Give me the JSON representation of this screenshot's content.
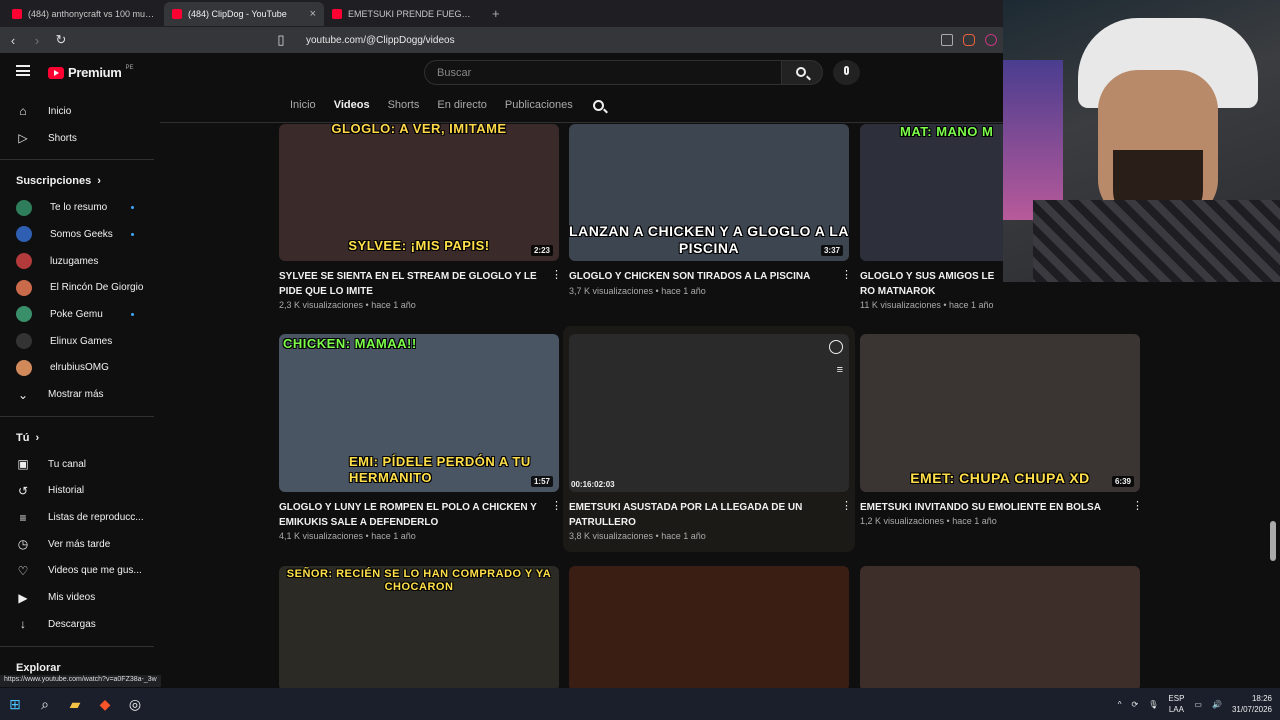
{
  "browser": {
    "tabs": [
      {
        "title": "(484) anthonycraft vs 100 mujeres - Y",
        "active": false
      },
      {
        "title": "(484) ClipDog - YouTube",
        "active": true
      },
      {
        "title": "EMETSUKI PRENDE FUEGOS ARTIFICI",
        "active": false
      }
    ],
    "new_tab": "+",
    "close_glyph": "×",
    "url": "youtube.com/@ClippDogg/videos",
    "status_url": "https://www.youtube.com/watch?v=a0FZ38a-_3w"
  },
  "youtube": {
    "logo_text": "Premium",
    "logo_region": "PE",
    "search_placeholder": "Buscar",
    "sidebar": {
      "main": [
        {
          "label": "Inicio",
          "icon": "home-icon"
        },
        {
          "label": "Shorts",
          "icon": "shorts-icon"
        }
      ],
      "subscriptions_header": "Suscripciones",
      "subscriptions": [
        {
          "label": "Te lo resumo",
          "color": "#2e7d5b",
          "new": true
        },
        {
          "label": "Somos Geeks",
          "color": "#2f5fb3",
          "new": true
        },
        {
          "label": "luzugames",
          "color": "#b33a3a",
          "new": false
        },
        {
          "label": "El Rincón De Giorgio",
          "color": "#c96a4a",
          "new": false
        },
        {
          "label": "Poke Gemu",
          "color": "#3a8f6b",
          "new": true
        },
        {
          "label": "Elinux Games",
          "color": "#333333",
          "new": false
        },
        {
          "label": "elrubiusOMG",
          "color": "#d08a5a",
          "new": false
        }
      ],
      "show_more": "Mostrar más",
      "you_header": "Tú",
      "you": [
        {
          "label": "Tu canal",
          "icon": "channel-icon"
        },
        {
          "label": "Historial",
          "icon": "history-icon"
        },
        {
          "label": "Listas de reproducc...",
          "icon": "playlist-icon"
        },
        {
          "label": "Ver más tarde",
          "icon": "watch-later-icon"
        },
        {
          "label": "Videos que me gus...",
          "icon": "like-icon"
        },
        {
          "label": "Mis videos",
          "icon": "my-videos-icon"
        },
        {
          "label": "Descargas",
          "icon": "download-icon"
        }
      ],
      "explore_header": "Explorar"
    },
    "channel_tabs": [
      {
        "label": "Inicio",
        "active": false
      },
      {
        "label": "Videos",
        "active": true
      },
      {
        "label": "Shorts",
        "active": false
      },
      {
        "label": "En directo",
        "active": false
      },
      {
        "label": "Publicaciones",
        "active": false
      }
    ],
    "videos": [
      {
        "caption_top": "GLOGLO: A VER, IMITAME",
        "caption": "SYLVEE: ¡MIS PAPIS!",
        "duration": "2:23",
        "title": "SYLVEE SE SIENTA EN EL STREAM DE GLOGLO  Y LE PIDE QUE LO IMITE",
        "meta": "2,3 K visualizaciones • hace 1 año",
        "bg": "#3a2a2a"
      },
      {
        "caption_top": "",
        "caption": "LANZAN A CHICKEN Y A GLOGLO A LA PISCINA",
        "duration": "3:37",
        "title": "GLOGLO Y CHICKEN SON TIRADOS A LA PISCINA",
        "meta": "3,7 K visualizaciones • hace 1 año",
        "bg": "#3d4550"
      },
      {
        "caption_top": "MAT: MANO M",
        "caption": "",
        "duration": "",
        "title": "GLOGLO Y SUS AMIGOS LE RO MATNAROK",
        "meta": "11 K visualizaciones • hace 1 año",
        "bg": "#2d2f3a"
      },
      {
        "caption_top": "CHICKEN: MAMAA!!",
        "caption": "EMI: PÍDELE PERDÓN A TU HERMANITO",
        "duration": "1:57",
        "title": "GLOGLO Y LUNY LE ROMPEN EL POLO A CHICKEN Y EMIKUKIS SALE A DEFENDERLO",
        "meta": "4,1 K visualizaciones • hace 1 año",
        "bg": "#4a5564"
      },
      {
        "caption_top": "",
        "caption": "",
        "duration": "00:16:02:03",
        "title": "EMETSUKI ASUSTADA POR LA LLEGADA DE UN PATRULLERO",
        "meta": "3,8 K visualizaciones • hace 1 año",
        "bg": "#2a2a2a"
      },
      {
        "caption_top": "",
        "caption": "EMET: CHUPA CHUPA XD",
        "duration": "6:39",
        "title": "EMETSUKI INVITANDO SU EMOLIENTE EN BOLSA",
        "meta": "1,2 K visualizaciones • hace 1 año",
        "bg": "#3a3432"
      },
      {
        "caption_top": "SEÑOR: RECIÉN SE LO HAN COMPRADO Y YA CHOCARON",
        "caption": "",
        "duration": "",
        "title": "",
        "meta": "",
        "bg": "#2b2a25"
      },
      {
        "caption_top": "",
        "caption": "",
        "duration": "",
        "title": "",
        "meta": "",
        "bg": "#3a1e14"
      },
      {
        "caption_top": "",
        "caption": "",
        "duration": "",
        "title": "",
        "meta": "",
        "bg": "#3d2e2a"
      }
    ],
    "kebab": "⋮"
  },
  "taskbar": {
    "lang": "ESP",
    "lang_sub": "LAA",
    "time": "18:26",
    "date": "31/07/2026",
    "tray_chevron": "^"
  }
}
